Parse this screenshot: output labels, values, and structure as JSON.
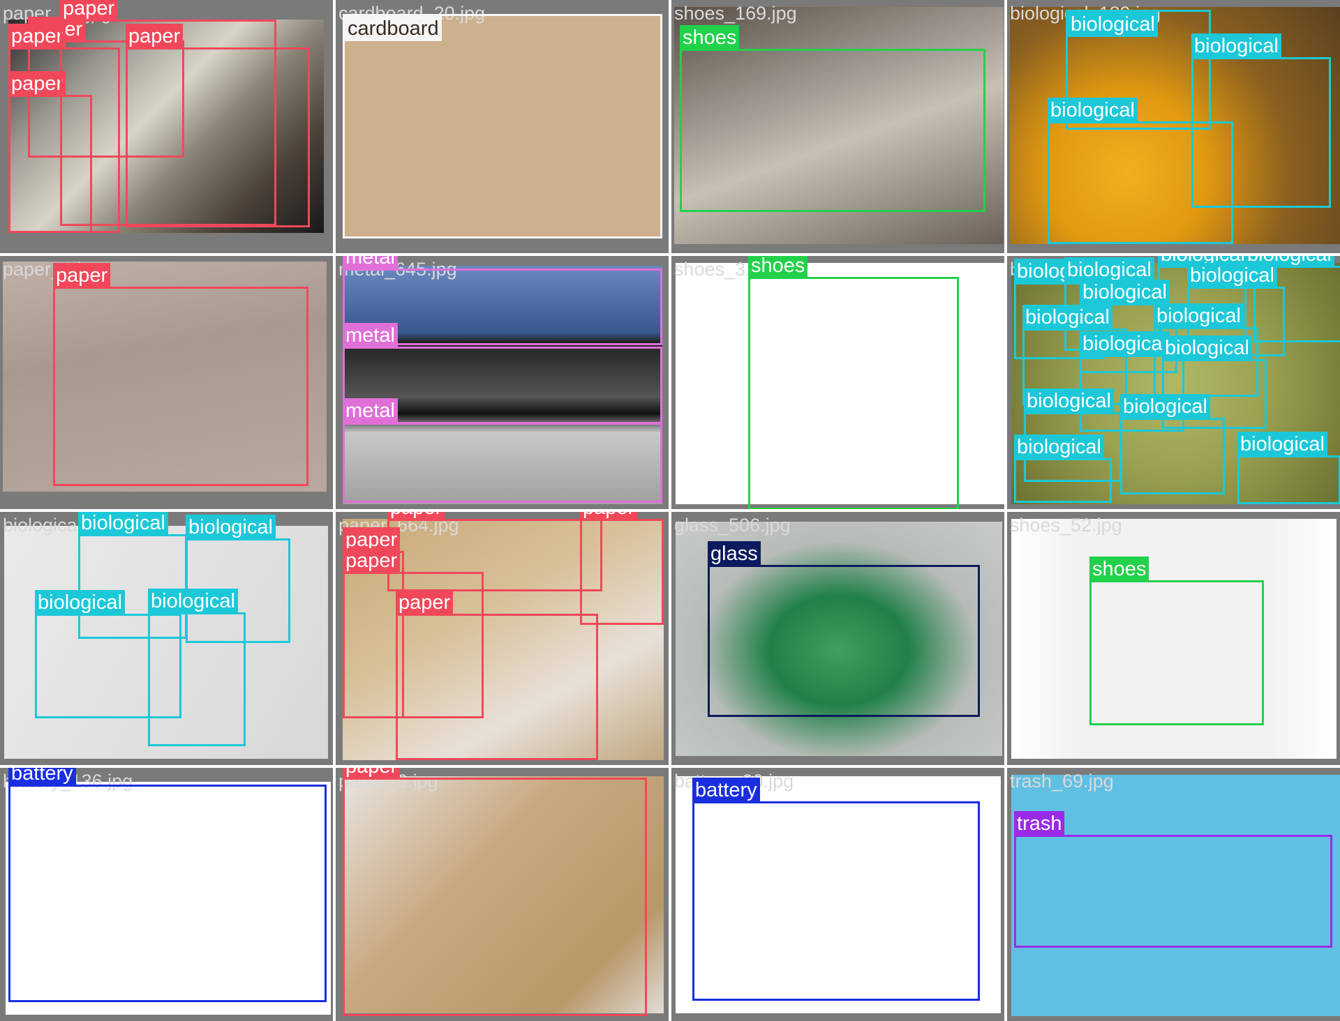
{
  "colors": {
    "paper": "#f0485a",
    "cardboard": "#f5f5f5",
    "shoes": "#22d14a",
    "biological": "#1cc8d8",
    "metal": "#e070d8",
    "glass": "#0c1a5e",
    "battery": "#1a2ee0",
    "trash": "#9a2ae8"
  },
  "tiles": [
    {
      "filename": "paper_11.jpg",
      "labels": [
        "paper",
        "paper",
        "paper",
        "paper",
        "paper"
      ]
    },
    {
      "filename": "cardboard_20.jpg",
      "labels": [
        "cardboard"
      ]
    },
    {
      "filename": "shoes_169.jpg",
      "labels": [
        "shoes"
      ]
    },
    {
      "filename": "biological_189.jpg",
      "labels": [
        "biological",
        "biological",
        "biological"
      ]
    },
    {
      "filename": "paper_4.jpg",
      "labels": [
        "paper"
      ]
    },
    {
      "filename": "metal_645.jpg",
      "labels": [
        "metal",
        "metal",
        "metal"
      ]
    },
    {
      "filename": "shoes_3.jpg",
      "labels": [
        "shoes"
      ]
    },
    {
      "filename": "biological_2.jpg",
      "labels": [
        "biological",
        "biological",
        "biological",
        "biological",
        "biological",
        "biological",
        "biological",
        "biological",
        "biological",
        "biological",
        "biological",
        "biological",
        "biological",
        "biological"
      ]
    },
    {
      "filename": "biological_8.jpg",
      "labels": [
        "biological",
        "biological",
        "biological",
        "biological"
      ]
    },
    {
      "filename": "paper_664.jpg",
      "labels": [
        "paper",
        "paper",
        "paper",
        "paper",
        "paper"
      ]
    },
    {
      "filename": "glass_506.jpg",
      "labels": [
        "glass"
      ]
    },
    {
      "filename": "shoes_52.jpg",
      "labels": [
        "shoes"
      ]
    },
    {
      "filename": "battery_136.jpg",
      "labels": [
        "battery"
      ]
    },
    {
      "filename": "paper_9.jpg",
      "labels": [
        "paper"
      ]
    },
    {
      "filename": "battery_30.jpg",
      "labels": [
        "battery"
      ]
    },
    {
      "filename": "trash_69.jpg",
      "labels": [
        "trash"
      ]
    }
  ]
}
